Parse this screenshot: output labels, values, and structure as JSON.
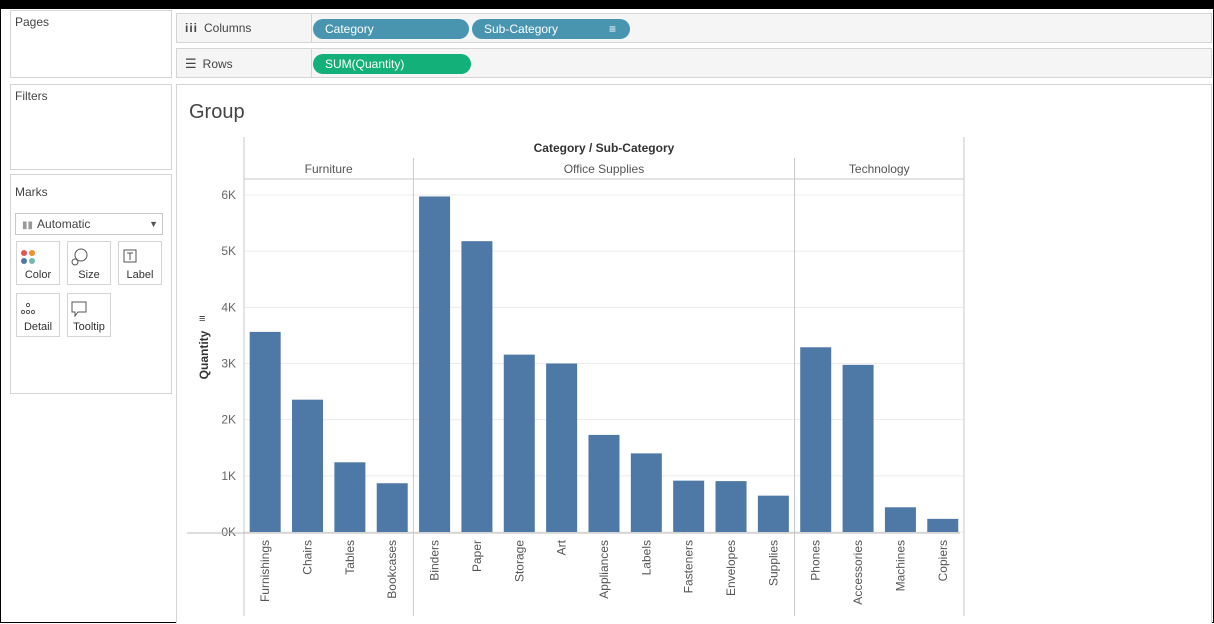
{
  "pages": {
    "title": "Pages"
  },
  "filters": {
    "title": "Filters"
  },
  "marks": {
    "title": "Marks",
    "type_selected": "Automatic",
    "buttons": [
      {
        "label": "Color",
        "icon": "color-icon"
      },
      {
        "label": "Size",
        "icon": "size-icon"
      },
      {
        "label": "Label",
        "icon": "label-icon"
      },
      {
        "label": "Detail",
        "icon": "detail-icon"
      },
      {
        "label": "Tooltip",
        "icon": "tooltip-icon"
      }
    ]
  },
  "columns_shelf": {
    "label": "Columns",
    "pills": [
      "Category",
      "Sub-Category"
    ]
  },
  "rows_shelf": {
    "label": "Rows",
    "pills": [
      "SUM(Quantity)"
    ]
  },
  "colors": {
    "bar": "#4e79a7",
    "dimension_pill": "#4995b0",
    "measure_pill": "#13b07a"
  },
  "sheet": {
    "title": "Group"
  },
  "chart_data": {
    "type": "bar",
    "header_title": "Category / Sub-Category",
    "ylabel": "Quantity",
    "ylim": [
      0,
      6000
    ],
    "yticks": [
      0,
      1000,
      2000,
      3000,
      4000,
      5000,
      6000
    ],
    "ytick_labels": [
      "0K",
      "1K",
      "2K",
      "3K",
      "4K",
      "5K",
      "6K"
    ],
    "gridlines": true,
    "groups": [
      {
        "name": "Furniture",
        "categories": [
          "Furnishings",
          "Chairs",
          "Tables",
          "Bookcases"
        ],
        "values": [
          3563,
          2356,
          1241,
          868
        ]
      },
      {
        "name": "Office Supplies",
        "categories": [
          "Binders",
          "Paper",
          "Storage",
          "Art",
          "Appliances",
          "Labels",
          "Fasteners",
          "Envelopes",
          "Supplies"
        ],
        "values": [
          5974,
          5178,
          3158,
          3000,
          1729,
          1400,
          914,
          906,
          647
        ]
      },
      {
        "name": "Technology",
        "categories": [
          "Phones",
          "Accessories",
          "Machines",
          "Copiers"
        ],
        "values": [
          3289,
          2976,
          440,
          234
        ]
      }
    ]
  }
}
